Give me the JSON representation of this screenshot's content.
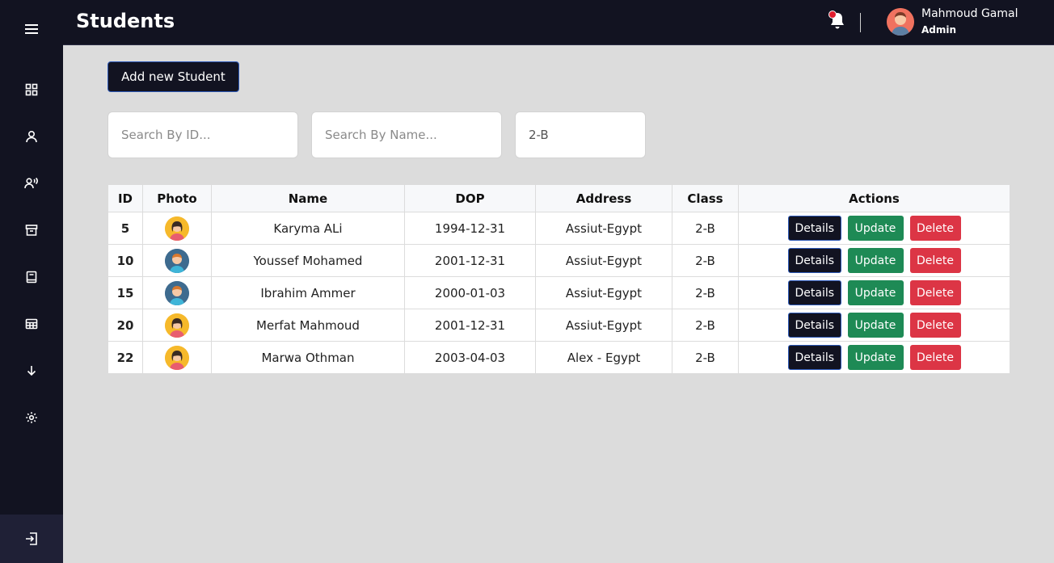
{
  "header": {
    "title": "Students",
    "user_name": "Mahmoud Gamal",
    "user_role": "Admin"
  },
  "sidebar": {
    "items": [
      {
        "icon": "dashboard-icon"
      },
      {
        "icon": "user-icon"
      },
      {
        "icon": "users-voice-icon"
      },
      {
        "icon": "archive-icon"
      },
      {
        "icon": "book-icon"
      },
      {
        "icon": "table-grid-icon"
      },
      {
        "icon": "arrow-down-icon"
      },
      {
        "icon": "gear-icon"
      }
    ],
    "logout_icon": "logout-icon"
  },
  "toolbar": {
    "add_label": "Add new Student"
  },
  "filters": {
    "search_id_placeholder": "Search By ID...",
    "search_name_placeholder": "Search By Name...",
    "class_value": "2-B"
  },
  "table": {
    "columns": [
      "ID",
      "Photo",
      "Name",
      "DOP",
      "Address",
      "Class",
      "Actions"
    ],
    "actions": {
      "details": "Details",
      "update": "Update",
      "delete": "Delete"
    },
    "rows": [
      {
        "id": "5",
        "photo": "female",
        "name": "Karyma ALi",
        "dop": "1994-12-31",
        "address": "Assiut-Egypt",
        "class": "2-B"
      },
      {
        "id": "10",
        "photo": "male",
        "name": "Youssef Mohamed",
        "dop": "2001-12-31",
        "address": "Assiut-Egypt",
        "class": "2-B"
      },
      {
        "id": "15",
        "photo": "male",
        "name": "Ibrahim Ammer",
        "dop": "2000-01-03",
        "address": "Assiut-Egypt",
        "class": "2-B"
      },
      {
        "id": "20",
        "photo": "female",
        "name": "Merfat Mahmoud",
        "dop": "2001-12-31",
        "address": "Assiut-Egypt",
        "class": "2-B"
      },
      {
        "id": "22",
        "photo": "female",
        "name": "Marwa Othman",
        "dop": "2003-04-03",
        "address": "Alex - Egypt",
        "class": "2-B"
      }
    ]
  },
  "colors": {
    "sidebar_bg": "#121321",
    "content_bg": "#dcdcdc",
    "update_green": "#1e8a55",
    "delete_red": "#dc3545",
    "notification_red": "#e11d2e"
  }
}
